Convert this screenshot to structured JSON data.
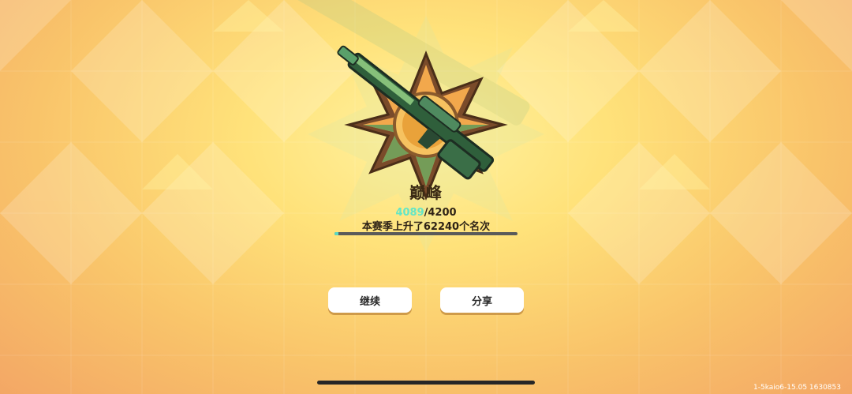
{
  "rank": {
    "title": "巅峰",
    "score_current": "4089",
    "score_max": "/4200",
    "rank_up_text": "本赛季上升了62240个名次",
    "progress_fraction": 0.02
  },
  "buttons": {
    "continue_label": "继续",
    "share_label": "分享"
  },
  "footer": {
    "version": "1-5kaio6-15.05 1630853"
  },
  "colors": {
    "background_top": "#fff2a0",
    "background_edge": "#f3a765",
    "score_highlight": "#63e6c6",
    "progress_fill": "#5ad8c2",
    "emblem_gold": "#e9a23a",
    "rifle_green": "#3f8a54"
  },
  "icons": {
    "emblem": "sniper-rifle-star-badge-icon"
  }
}
